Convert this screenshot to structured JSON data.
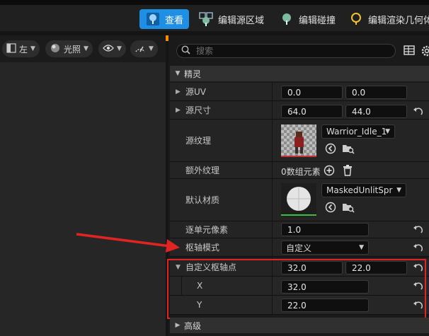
{
  "toolbar": {
    "view_label": "查看",
    "edit_source_region_label": "编辑源区域",
    "edit_collision_label": "编辑碰撞",
    "edit_render_geometry_label": "编辑渲染几何体"
  },
  "viewport_toolbar": {
    "view_mode": "左",
    "lighting": "光照"
  },
  "search": {
    "placeholder": "搜索"
  },
  "categories": {
    "sprite": "精灵",
    "advanced": "高级"
  },
  "properties": {
    "source_uv": {
      "label": "源UV",
      "x": "0.0",
      "y": "0.0"
    },
    "source_dimension": {
      "label": "源尺寸",
      "x": "64.0",
      "y": "44.0"
    },
    "source_texture": {
      "label": "源纹理",
      "value": "Warrior_Idle_1"
    },
    "additional_textures": {
      "label": "额外纹理",
      "value": "0数组元素"
    },
    "default_material": {
      "label": "默认材质",
      "value": "MaskedUnlitSpriteMaterial"
    },
    "pixels_per_unit": {
      "label": "逐单元像素",
      "value": "1.0"
    },
    "pivot_mode": {
      "label": "枢轴模式",
      "value": "自定义"
    },
    "custom_pivot_point": {
      "label": "自定义枢轴点",
      "x": "32.0",
      "y": "22.0",
      "x_label": "X",
      "y_label": "Y"
    }
  },
  "colors": {
    "accent": "#1f8fe6",
    "highlight": "#e02424",
    "scroll_marker": "#ff8a00"
  }
}
